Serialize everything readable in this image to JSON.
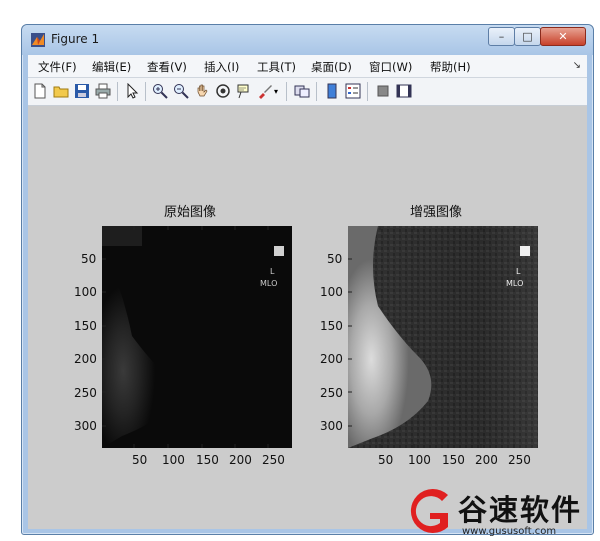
{
  "window": {
    "title": "Figure 1",
    "controls": {
      "minimize": "–",
      "maximize": "□",
      "close": "✕"
    }
  },
  "menubar": {
    "items": [
      "文件(F)",
      "编辑(E)",
      "查看(V)",
      "插入(I)",
      "工具(T)",
      "桌面(D)",
      "窗口(W)",
      "帮助(H)"
    ],
    "overflow_icon": "chevron-icon"
  },
  "toolbar": {
    "icons": [
      "new-figure-icon",
      "open-icon",
      "save-icon",
      "print-icon",
      "pointer-icon",
      "zoom-in-icon",
      "zoom-out-icon",
      "pan-icon",
      "rotate-3d-icon",
      "data-cursor-icon",
      "brush-icon",
      "link-icon",
      "colorbar-icon",
      "legend-icon",
      "hide-plot-tools-icon",
      "show-plot-tools-icon"
    ]
  },
  "plots": [
    {
      "title": "原始图像",
      "x_ticks": [
        "50",
        "100",
        "150",
        "200",
        "250"
      ],
      "y_ticks": [
        "50",
        "100",
        "150",
        "200",
        "250",
        "300"
      ]
    },
    {
      "title": "增强图像",
      "x_ticks": [
        "50",
        "100",
        "150",
        "200",
        "250"
      ],
      "y_ticks": [
        "50",
        "100",
        "150",
        "200",
        "250",
        "300"
      ]
    }
  ],
  "watermark": {
    "brand": "谷速软件",
    "url": "www.gususoft.com",
    "logo_color": "#e02020"
  }
}
